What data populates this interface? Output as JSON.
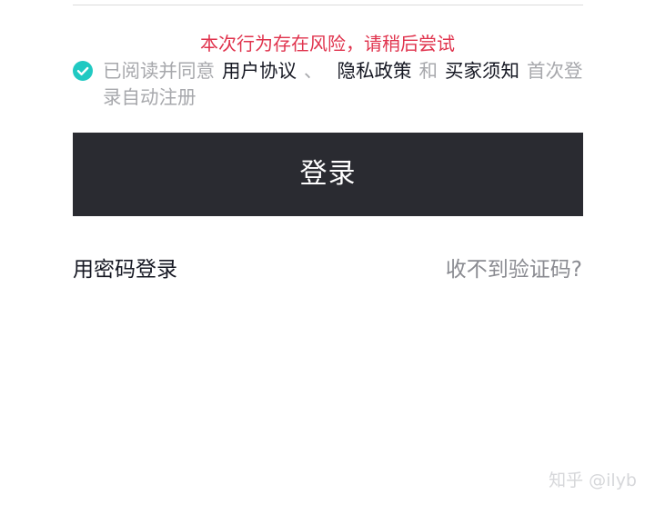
{
  "warning": {
    "text": "本次行为存在风险，请稍后尝试",
    "color": "#e0334d"
  },
  "agreement": {
    "checked": true,
    "check_icon": "check-circle-icon",
    "check_color": "#20c9c2",
    "prefix": "已阅读并同意",
    "user_agreement": "用户协议",
    "separator": "、",
    "privacy_policy": "隐私政策",
    "and": "和",
    "buyer_notice": "买家须知",
    "suffix": "首次登录自动注册"
  },
  "login_button": {
    "label": "登录",
    "background": "#2a2b31"
  },
  "links": {
    "password_login": "用密码登录",
    "no_code": "收不到验证码?"
  },
  "watermark": {
    "text": "知乎 @ilyb"
  }
}
